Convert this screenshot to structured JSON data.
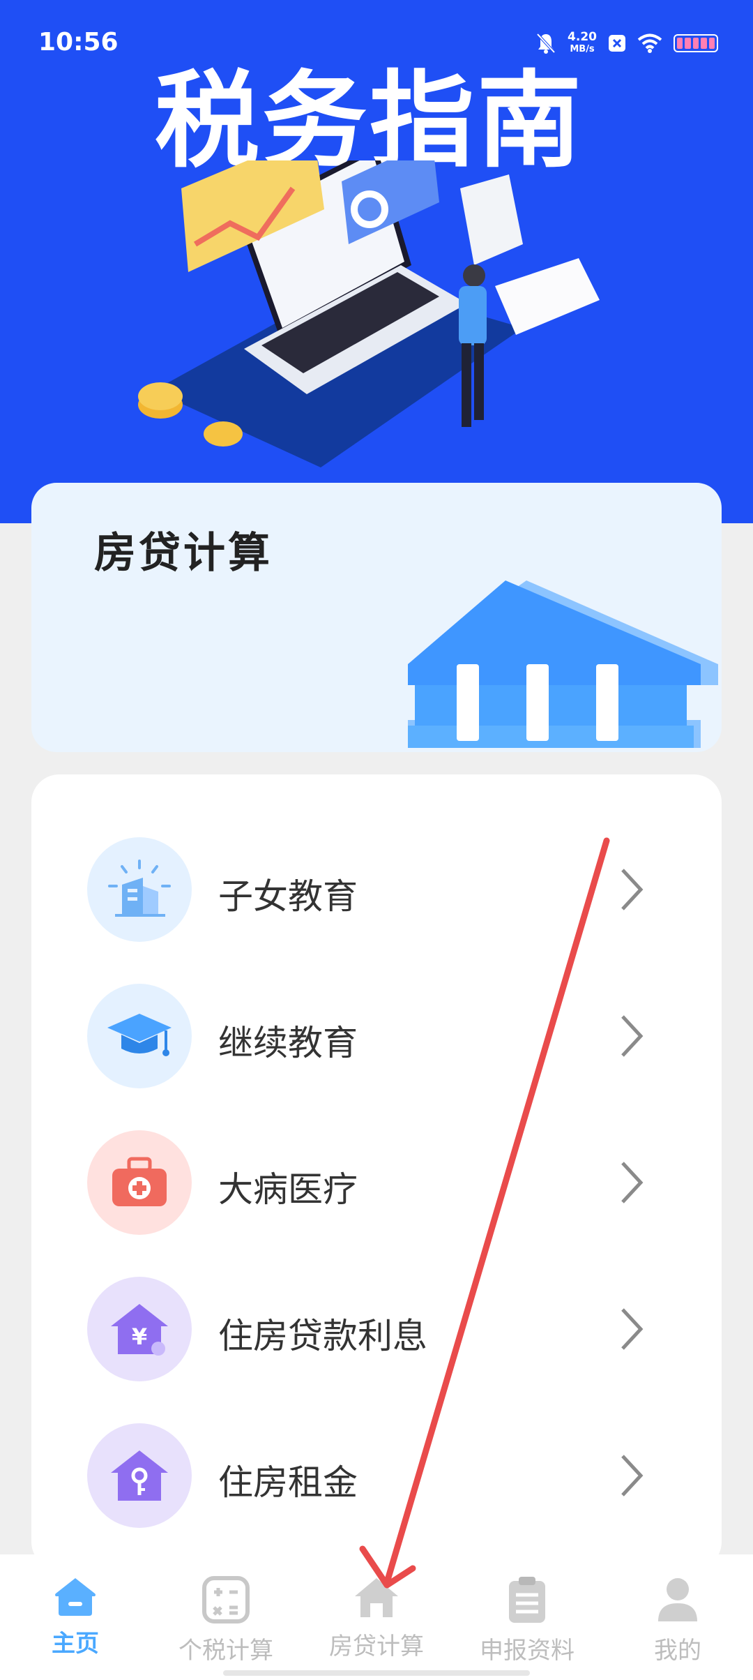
{
  "status_bar": {
    "time": "10:56",
    "net_speed_value": "4.20",
    "net_speed_unit": "MB/s"
  },
  "header": {
    "title": "税务指南"
  },
  "mortgage_card": {
    "title": "房贷计算"
  },
  "deductions": [
    {
      "label": "子女教育",
      "icon": "school-building-icon"
    },
    {
      "label": "继续教育",
      "icon": "graduation-cap-icon"
    },
    {
      "label": "大病医疗",
      "icon": "medical-kit-icon"
    },
    {
      "label": "住房贷款利息",
      "icon": "house-yuan-icon"
    },
    {
      "label": "住房租金",
      "icon": "house-key-icon"
    }
  ],
  "tabbar": {
    "tabs": [
      {
        "label": "主页",
        "icon": "home-icon",
        "active": true
      },
      {
        "label": "个税计算",
        "icon": "calculator-icon",
        "active": false
      },
      {
        "label": "房贷计算",
        "icon": "house-icon",
        "active": false
      },
      {
        "label": "申报资料",
        "icon": "clipboard-icon",
        "active": false
      },
      {
        "label": "我的",
        "icon": "user-icon",
        "active": false
      }
    ]
  },
  "colors": {
    "primary": "#1f4ff5",
    "active_tab": "#4aa8ff",
    "arrow": "#e94b4b"
  }
}
